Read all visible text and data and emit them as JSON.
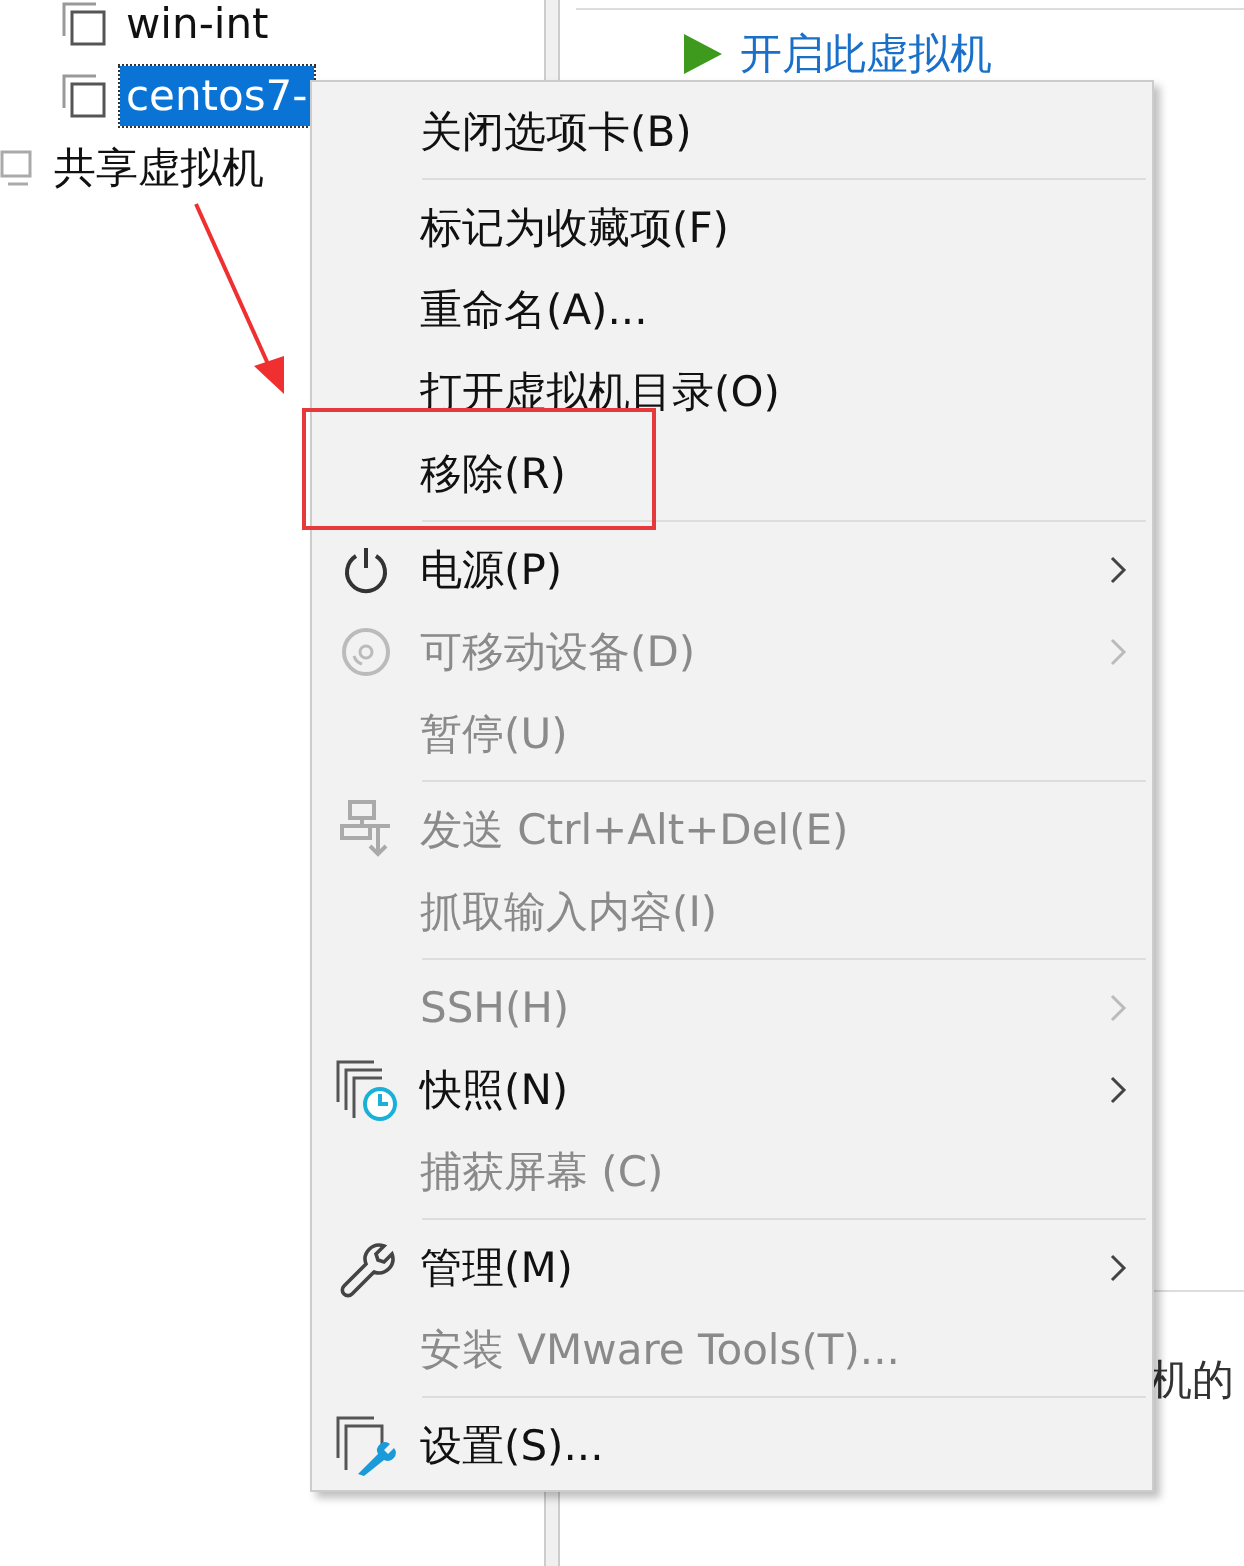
{
  "tree": {
    "items": [
      {
        "label": "win-int",
        "selected": false,
        "kind": "vm"
      },
      {
        "label": "centos7-",
        "selected": true,
        "kind": "vm"
      },
      {
        "label": "共享虚拟机",
        "selected": false,
        "kind": "shared"
      }
    ]
  },
  "details": {
    "power_on_link": "开启此虚拟机",
    "cut_text": "机的"
  },
  "context_menu": {
    "items": [
      {
        "kind": "plain",
        "label": "关闭选项卡(B)",
        "disabled": false,
        "submenu": false
      },
      {
        "kind": "separator"
      },
      {
        "kind": "plain",
        "label": "标记为收藏项(F)",
        "disabled": false,
        "submenu": false
      },
      {
        "kind": "plain",
        "label": "重命名(A)...",
        "disabled": false,
        "submenu": false
      },
      {
        "kind": "plain",
        "label": "打开虚拟机目录(O)",
        "disabled": false,
        "submenu": false
      },
      {
        "kind": "plain",
        "label": "移除(R)",
        "disabled": false,
        "submenu": false,
        "highlighted": true
      },
      {
        "kind": "separator"
      },
      {
        "kind": "power",
        "label": "电源(P)",
        "disabled": false,
        "submenu": true
      },
      {
        "kind": "disc",
        "label": "可移动设备(D)",
        "disabled": true,
        "submenu": true
      },
      {
        "kind": "plain",
        "label": "暂停(U)",
        "disabled": true,
        "submenu": false
      },
      {
        "kind": "separator"
      },
      {
        "kind": "send",
        "label": "发送 Ctrl+Alt+Del(E)",
        "disabled": true,
        "submenu": false
      },
      {
        "kind": "plain",
        "label": "抓取输入内容(I)",
        "disabled": true,
        "submenu": false
      },
      {
        "kind": "separator"
      },
      {
        "kind": "plain",
        "label": "SSH(H)",
        "disabled": true,
        "submenu": true
      },
      {
        "kind": "snapshot",
        "label": "快照(N)",
        "disabled": false,
        "submenu": true
      },
      {
        "kind": "plain",
        "label": "捕获屏幕 (C)",
        "disabled": true,
        "submenu": false
      },
      {
        "kind": "separator"
      },
      {
        "kind": "wrench",
        "label": "管理(M)",
        "disabled": false,
        "submenu": true
      },
      {
        "kind": "plain",
        "label": "安装 VMware Tools(T)...",
        "disabled": true,
        "submenu": false
      },
      {
        "kind": "separator"
      },
      {
        "kind": "settings",
        "label": "设置(S)...",
        "disabled": false,
        "submenu": false
      }
    ]
  }
}
